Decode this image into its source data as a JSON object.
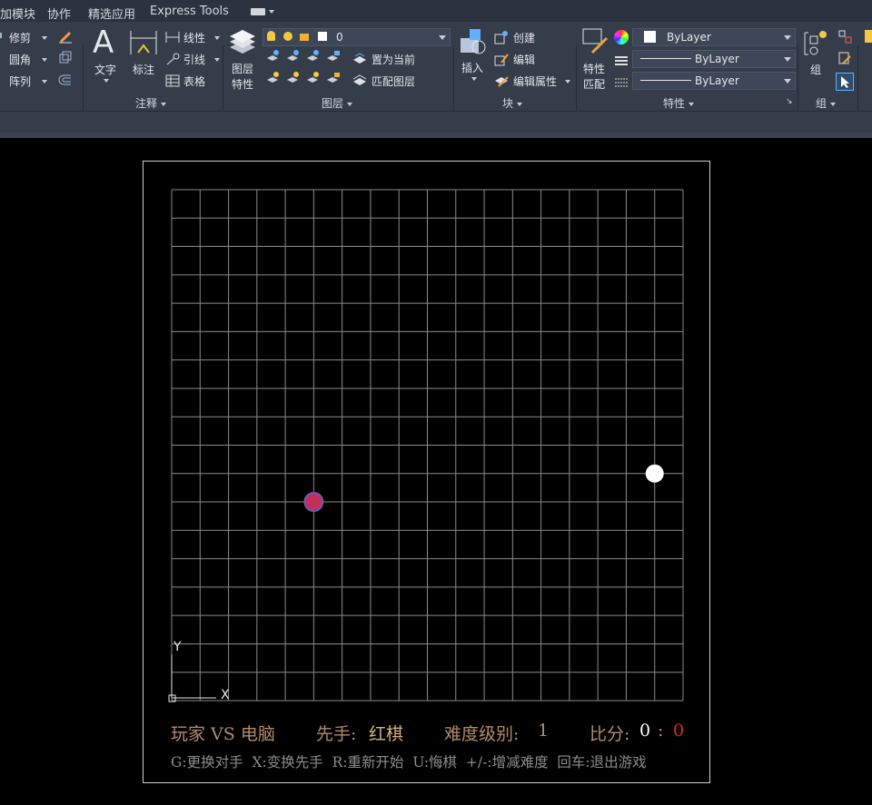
{
  "tabs": [
    "加模块",
    "协作",
    "精选应用",
    "Express Tools"
  ],
  "panels": {
    "modify": {
      "trim_label": "修剪",
      "fillet_label": "圆角",
      "array_label": "阵列"
    },
    "annotation": {
      "title": "注释",
      "text_label": "文字",
      "dimension_label": "标注",
      "linear_label": "线性",
      "leader_label": "引线",
      "table_label": "表格"
    },
    "layers": {
      "title": "图层",
      "layer_props_label": "图层\n特性",
      "current_layer": "0",
      "set_current_label": "置为当前",
      "match_layer_label": "匹配图层"
    },
    "block": {
      "title": "块",
      "insert_label": "插入",
      "create_label": "创建",
      "edit_label": "编辑",
      "edit_attr_label": "编辑属性"
    },
    "properties": {
      "title": "特性",
      "match_label": "特性\n匹配",
      "color_value": "ByLayer",
      "linetype_value": "ByLayer",
      "lineweight_value": "ByLayer"
    },
    "groups": {
      "title": "组",
      "group_label": "组"
    }
  },
  "board": {
    "rows": 18,
    "cols": 18
  },
  "stones": [
    {
      "color": "red",
      "col": 5,
      "row": 11
    },
    {
      "color": "white",
      "col": 17,
      "row": 10
    }
  ],
  "ucs": {
    "x_label": "X",
    "y_label": "Y"
  },
  "status": {
    "players": "玩家 VS 电脑",
    "first_label": "先手:",
    "first_value": "红棋",
    "difficulty_label": "难度级别:",
    "difficulty_value": "1",
    "score_label": "比分:",
    "score_white": "0",
    "score_sep": ":",
    "score_red": "0",
    "help": "G:更换对手  X:变换先手  R:重新开始  U:悔棋  +/-:增减难度  回车:退出游戏"
  },
  "colors": {
    "grid": "#8a8a8a",
    "red_stone": "#c0305a",
    "white_stone": "#ffffff",
    "status_text": "#b38b6d",
    "help_text": "#8c8c8c",
    "score_red": "#e02a2a"
  }
}
